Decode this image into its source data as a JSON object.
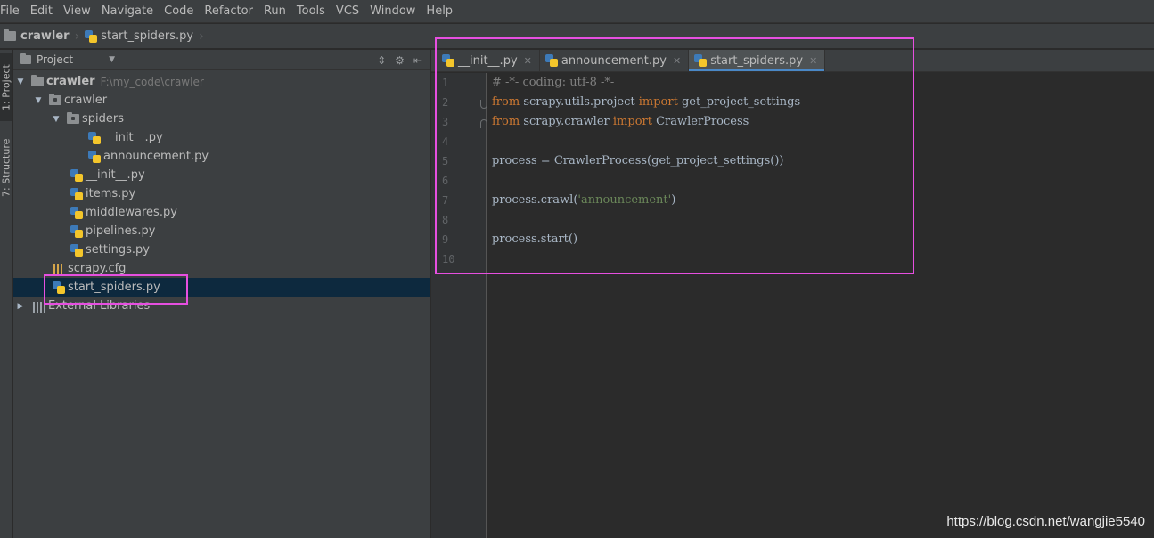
{
  "menu": [
    "File",
    "Edit",
    "View",
    "Navigate",
    "Code",
    "Refactor",
    "Run",
    "Tools",
    "VCS",
    "Window",
    "Help"
  ],
  "breadcrumb": {
    "project": "crawler",
    "file": "start_spiders.py"
  },
  "tool_stripe": {
    "project": "1: Project",
    "structure": "7: Structure"
  },
  "project_panel": {
    "title": "Project",
    "tree": [
      {
        "label": "crawler",
        "path": "F:\\my_code\\crawler",
        "icon": "folder-icon"
      },
      {
        "label": "crawler",
        "icon": "folder-icon"
      },
      {
        "label": "spiders",
        "icon": "package-icon"
      },
      {
        "label": "__init__.py",
        "icon": "python-file-icon"
      },
      {
        "label": "announcement.py",
        "icon": "python-file-icon"
      },
      {
        "label": "__init__.py",
        "icon": "python-file-icon"
      },
      {
        "label": "items.py",
        "icon": "python-file-icon"
      },
      {
        "label": "middlewares.py",
        "icon": "python-file-icon"
      },
      {
        "label": "pipelines.py",
        "icon": "python-file-icon"
      },
      {
        "label": "settings.py",
        "icon": "python-file-icon"
      },
      {
        "label": "scrapy.cfg",
        "icon": "config-file-icon"
      },
      {
        "label": "start_spiders.py",
        "icon": "python-file-icon",
        "selected": true
      },
      {
        "label": "External Libraries",
        "icon": "libraries-icon"
      }
    ]
  },
  "editor": {
    "tabs": [
      {
        "label": "__init__.py",
        "active": false
      },
      {
        "label": "announcement.py",
        "active": false
      },
      {
        "label": "start_spiders.py",
        "active": true
      }
    ],
    "line_numbers": [
      "1",
      "2",
      "3",
      "4",
      "5",
      "6",
      "7",
      "8",
      "9",
      "10"
    ],
    "code": {
      "l1": "# -*- coding: utf-8 -*-",
      "l2_kw1": "from",
      "l2_mod": " scrapy.utils.project ",
      "l2_kw2": "import",
      "l2_name": " get_project_settings",
      "l3_kw1": "from",
      "l3_mod": " scrapy.crawler ",
      "l3_kw2": "import",
      "l3_name": " CrawlerProcess",
      "l5": "process = CrawlerProcess(get_project_settings())",
      "l7_pre": "process.crawl(",
      "l7_str": "'announcement'",
      "l7_post": ")",
      "l9": "process.start()"
    }
  },
  "watermark": "https://blog.csdn.net/wangjie5540",
  "colors": {
    "highlight_box": "#e64fe0",
    "keyword": "#cc7832",
    "string": "#6a8759",
    "comment": "#808080",
    "selection": "#0d293e",
    "tab_underline": "#4a88c7"
  }
}
